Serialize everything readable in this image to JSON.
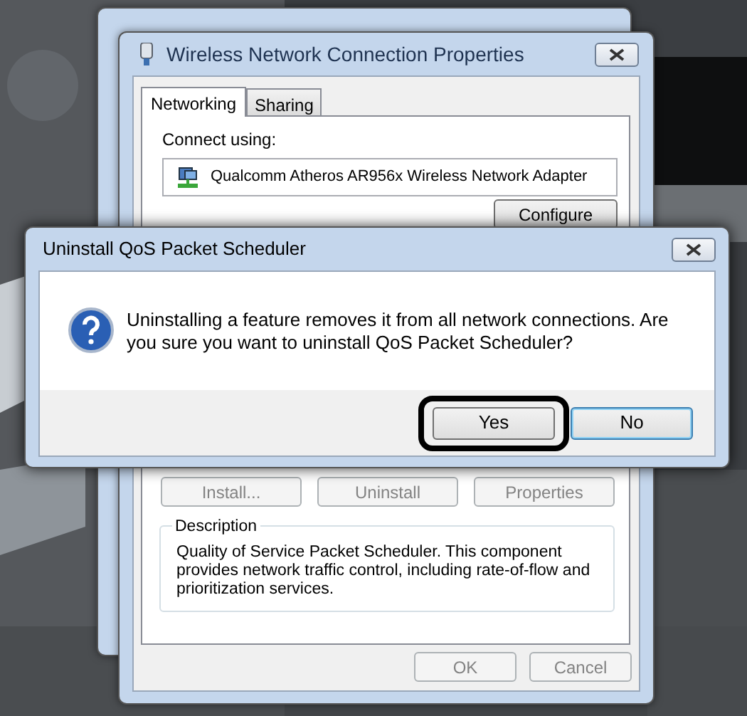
{
  "properties_window": {
    "title": "Wireless Network Connection Properties",
    "tabs": [
      {
        "label": "Networking",
        "selected": true
      },
      {
        "label": "Sharing",
        "selected": false
      }
    ],
    "connect_using_label": "Connect using:",
    "adapter": "Qualcomm Atheros AR956x Wireless Network Adapter",
    "configure_button": {
      "label": "Configure",
      "disabled": false
    },
    "item_buttons": [
      {
        "label": "Install...",
        "disabled": true
      },
      {
        "label": "Uninstall",
        "disabled": true
      },
      {
        "label": "Properties",
        "disabled": true
      }
    ],
    "description_label": "Description",
    "description": "Quality of Service Packet Scheduler.  This component provides network traffic control, including rate-of-flow and prioritization services.",
    "buttons": [
      {
        "label": "OK",
        "disabled": true
      },
      {
        "label": "Cancel",
        "disabled": true
      }
    ]
  },
  "dialog": {
    "title": "Uninstall QoS Packet Scheduler",
    "message": "Uninstalling a feature removes it from all network connections. Are you sure you want to uninstall QoS Packet Scheduler?",
    "buttons": [
      {
        "label": "Yes",
        "default": false,
        "circled": true
      },
      {
        "label": "No",
        "default": true,
        "circled": false
      }
    ]
  }
}
